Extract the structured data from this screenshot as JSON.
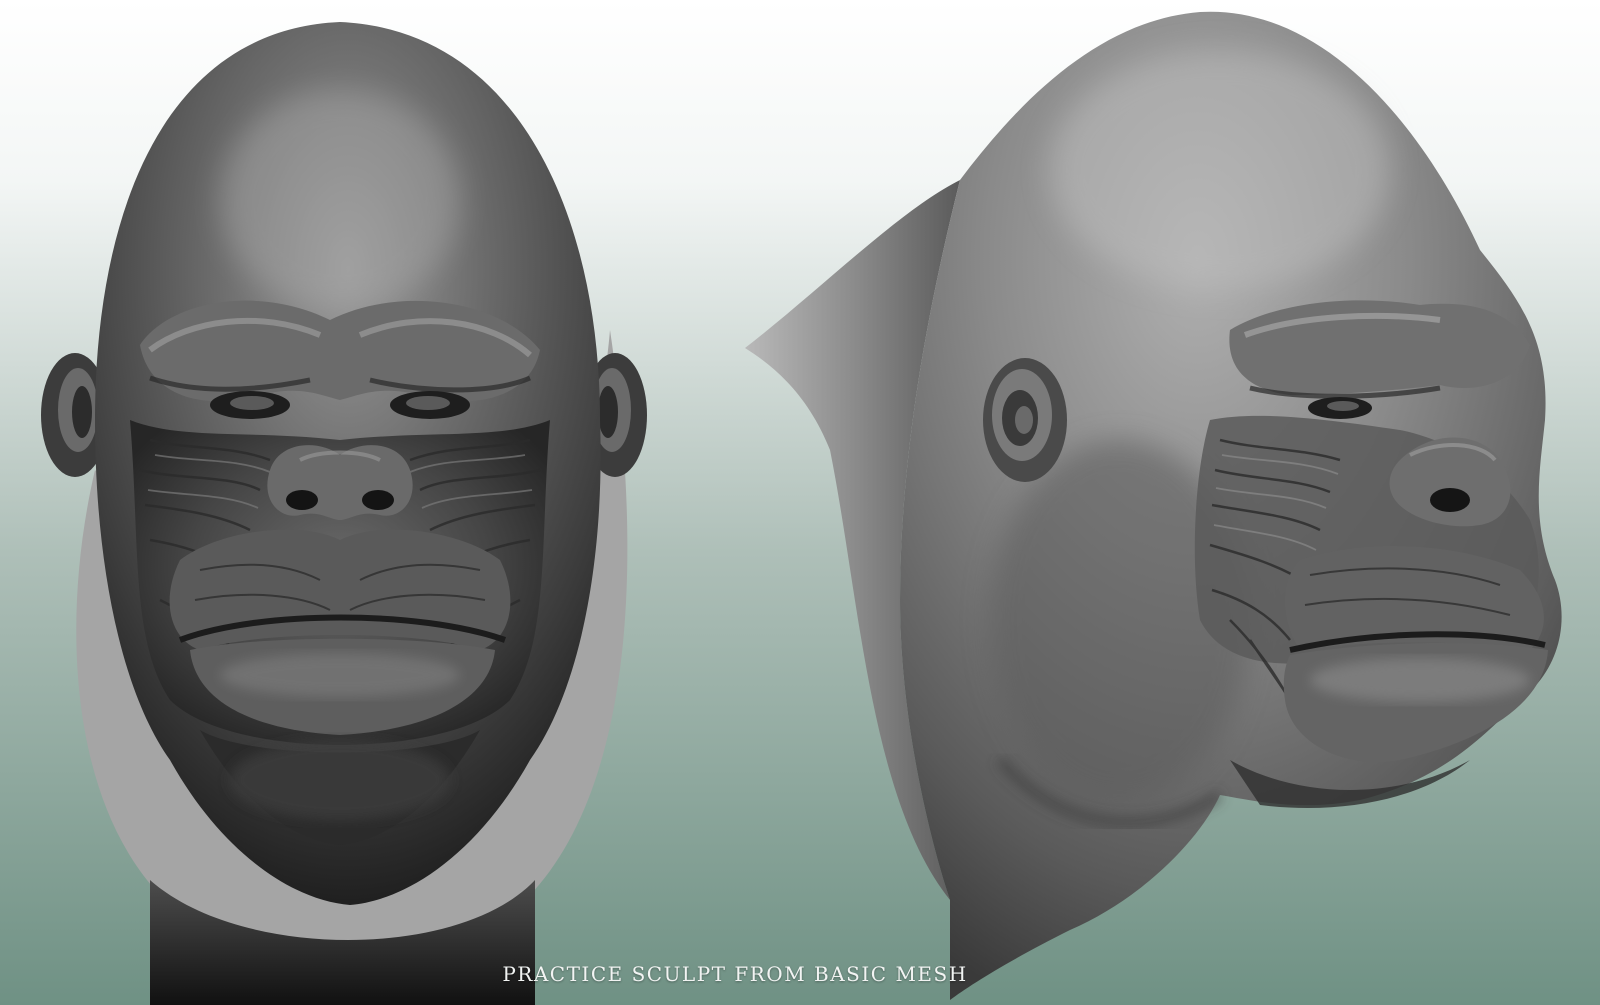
{
  "caption": "PRACTICE SCULPT FROM BASIC MESH",
  "colors": {
    "background_top": "#ffffff",
    "background_bottom": "#6f9184",
    "sculpt_base": "#4a4a4a",
    "sculpt_highlight": "#8a8a8a",
    "sculpt_shadow": "#111111",
    "caption_text": "#f2f4f3"
  }
}
